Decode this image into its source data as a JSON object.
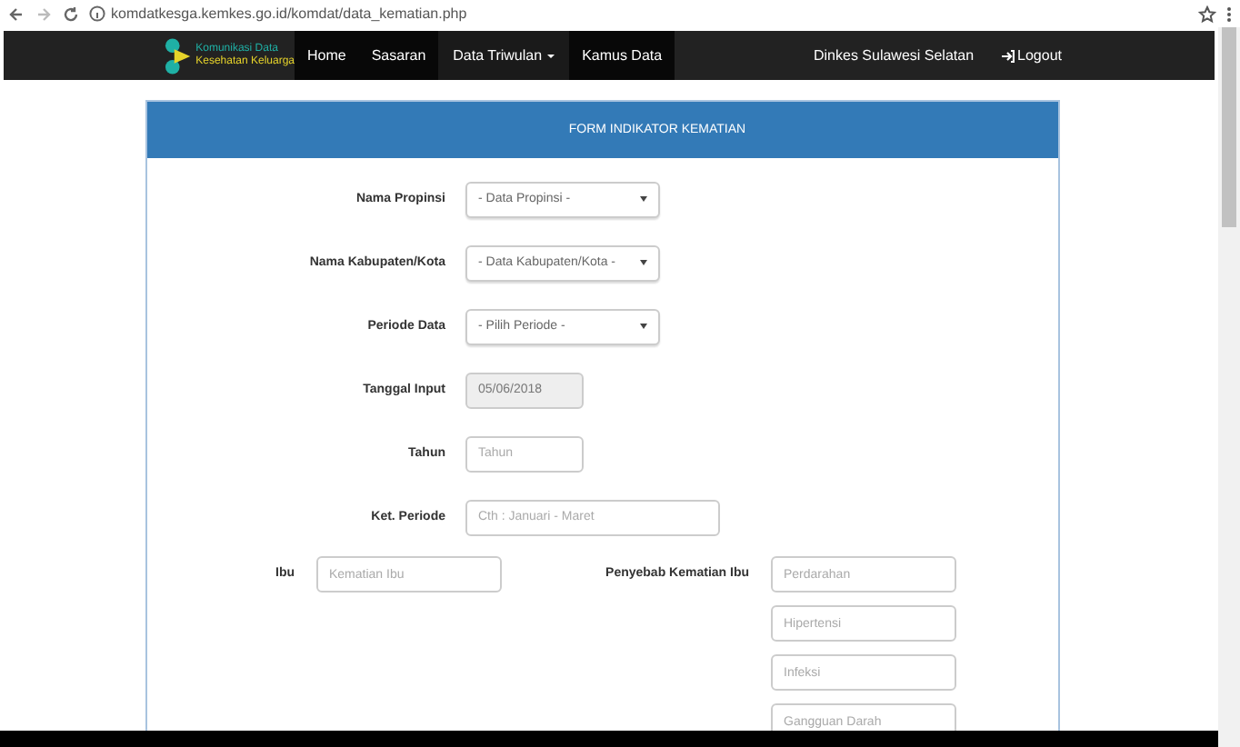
{
  "browser": {
    "url": "komdatkesga.kemkes.go.id/komdat/data_kematian.php"
  },
  "navbar": {
    "logo_lines": [
      "Komunikasi Data",
      "Kesehatan Keluarga"
    ],
    "items": [
      {
        "label": "Home",
        "selected": false,
        "dropdown": false
      },
      {
        "label": "Sasaran",
        "selected": false,
        "dropdown": false
      },
      {
        "label": "Data Triwulan",
        "selected": true,
        "dropdown": true
      },
      {
        "label": "Kamus Data",
        "selected": false,
        "dropdown": false
      }
    ],
    "user": "Dinkes Sulawesi Selatan",
    "logout": "Logout"
  },
  "form": {
    "title": "FORM INDIKATOR KEMATIAN",
    "fields": [
      {
        "label": "Nama Propinsi",
        "kind": "select",
        "value": "- Data Propinsi -"
      },
      {
        "label": "Nama Kabupaten/Kota",
        "kind": "select",
        "value": "- Data Kabupaten/Kota -"
      },
      {
        "label": "Periode Data",
        "kind": "select",
        "value": "- Pilih Periode -"
      },
      {
        "label": "Tanggal Input",
        "kind": "readonly",
        "value": "05/06/2018"
      },
      {
        "label": "Tahun",
        "kind": "short",
        "placeholder": "Tahun"
      },
      {
        "label": "Ket. Periode",
        "kind": "wide",
        "placeholder": "Cth : Januari - Maret"
      }
    ],
    "ibu": {
      "label": "Ibu",
      "placeholder": "Kematian Ibu"
    },
    "causes": {
      "label": "Penyebab Kematian Ibu",
      "placeholders": [
        "Perdarahan",
        "Hipertensi",
        "Infeksi",
        "Gangguan Darah"
      ]
    }
  }
}
